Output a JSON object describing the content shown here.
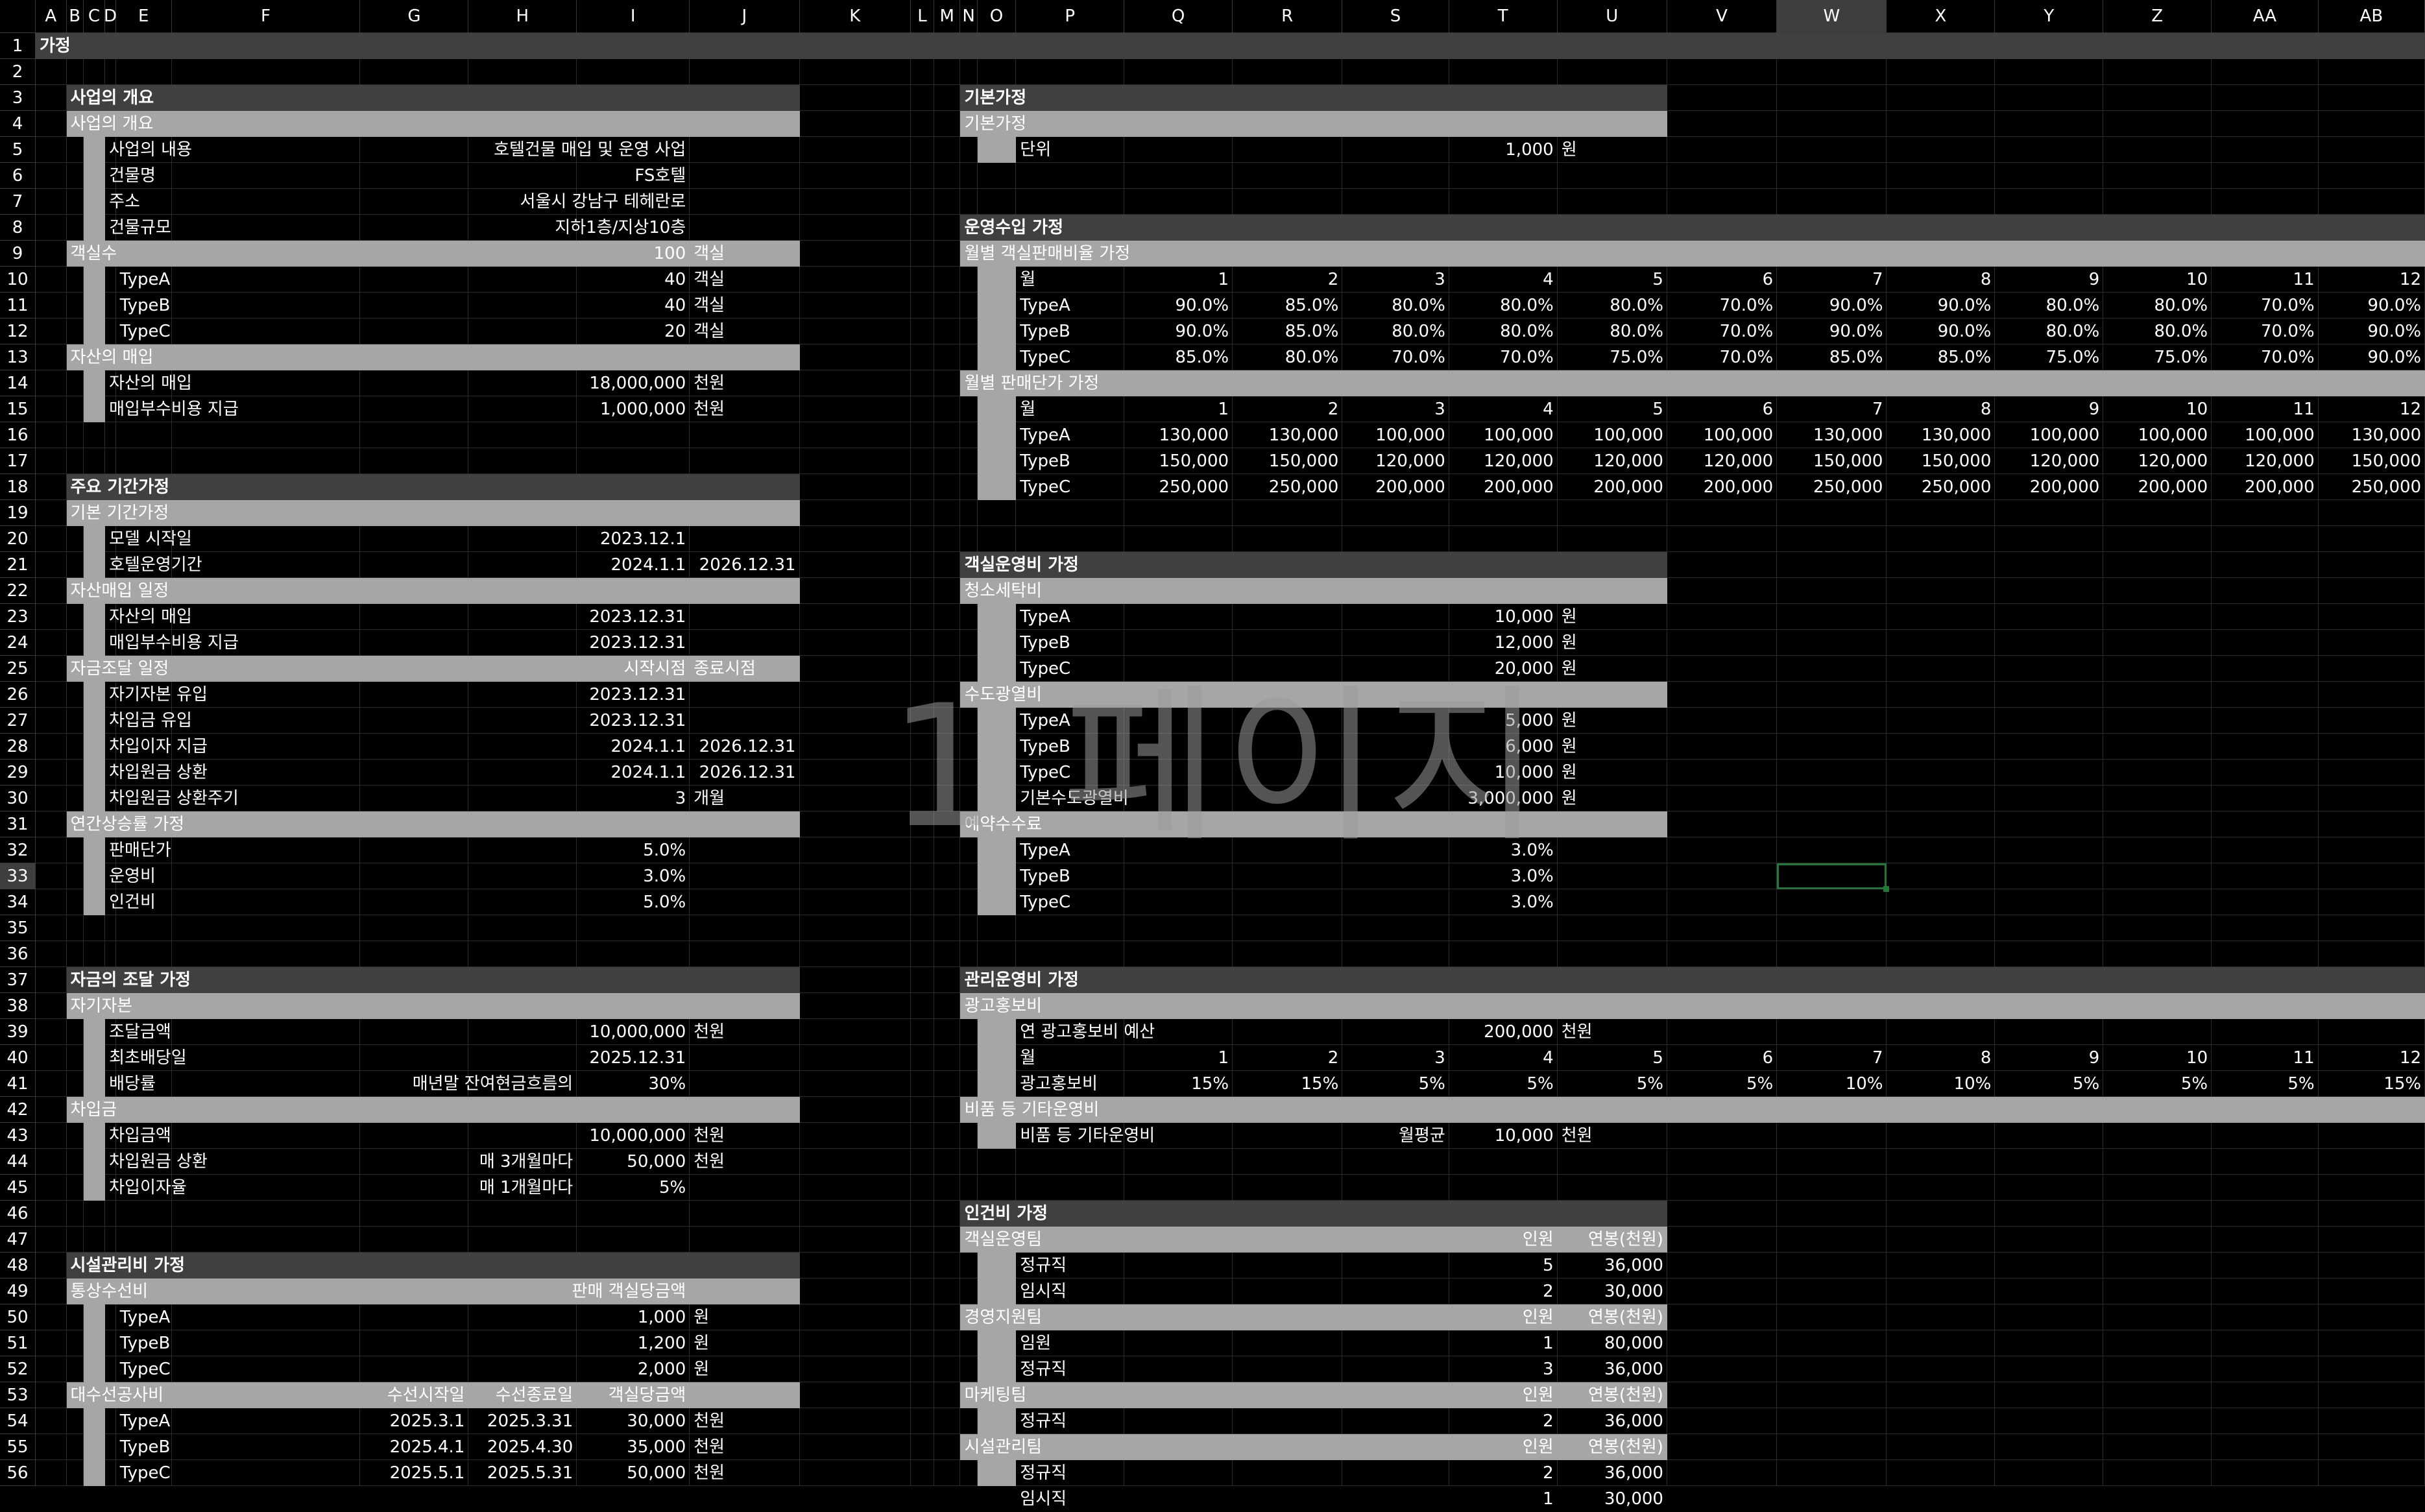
{
  "sheet": {
    "columns": [
      "A",
      "B",
      "C",
      "D",
      "E",
      "F",
      "G",
      "H",
      "I",
      "J",
      "K",
      "L",
      "M",
      "N",
      "O",
      "P",
      "Q",
      "R",
      "S",
      "T",
      "U",
      "V",
      "W",
      "X",
      "Y",
      "Z",
      "AA",
      "AB"
    ],
    "selected_column": "W",
    "selected_row": "33",
    "page_watermark": "1 페이지"
  },
  "title_row": "가정",
  "left": {
    "s1_title": "사업의 개요",
    "s1_sub": "사업의 개요",
    "s1_rows": [
      {
        "label": "사업의 내용",
        "val": "호텔건물 매입 및 운영 사업"
      },
      {
        "label": "건물명",
        "val": "FS호텔"
      },
      {
        "label": "주소",
        "val": "서울시 강남구 테헤란로"
      },
      {
        "label": "건물규모",
        "val": "지하1층/지상10층"
      }
    ],
    "rooms_label": "객실수",
    "rooms_val": "100",
    "rooms_unit": "객실",
    "rooms_rows": [
      {
        "label": "TypeA",
        "val": "40",
        "unit": "객실"
      },
      {
        "label": "TypeB",
        "val": "40",
        "unit": "객실"
      },
      {
        "label": "TypeC",
        "val": "20",
        "unit": "객실"
      }
    ],
    "asset_label": "자산의 매입",
    "asset_rows": [
      {
        "label": "자산의 매입",
        "val": "18,000,000",
        "unit": "천원"
      },
      {
        "label": "매입부수비용 지급",
        "val": "1,000,000",
        "unit": "천원"
      }
    ],
    "s2_title": "주요 기간가정",
    "basic_period": "기본 기간가정",
    "basic_rows": [
      {
        "label": "모델 시작일",
        "v1": "2023.12.1",
        "v2": ""
      },
      {
        "label": "호텔운영기간",
        "v1": "2024.1.1",
        "v2": "2026.12.31"
      }
    ],
    "asset_sched": "자산매입 일정",
    "asset_sched_rows": [
      {
        "label": "자산의 매입",
        "v1": "2023.12.31"
      },
      {
        "label": "매입부수비용 지급",
        "v1": "2023.12.31"
      }
    ],
    "fund_sched": "자금조달 일정",
    "fund_start": "시작시점",
    "fund_end": "종료시점",
    "fund_rows": [
      {
        "label": "자기자본 유입",
        "v1": "2023.12.31",
        "v2": ""
      },
      {
        "label": "차입금 유입",
        "v1": "2023.12.31",
        "v2": ""
      },
      {
        "label": "차입이자 지급",
        "v1": "2024.1.1",
        "v2": "2026.12.31"
      },
      {
        "label": "차입원금 상환",
        "v1": "2024.1.1",
        "v2": "2026.12.31"
      },
      {
        "label": "차입원금 상환주기",
        "v1": "3",
        "v2": "개월"
      }
    ],
    "growth": "연간상승률 가정",
    "growth_rows": [
      {
        "label": "판매단가",
        "v1": "5.0%"
      },
      {
        "label": "운영비",
        "v1": "3.0%"
      },
      {
        "label": "인건비",
        "v1": "5.0%"
      }
    ],
    "s3_title": "자금의 조달 가정",
    "equity": "자기자본",
    "equity_rows": [
      {
        "label": "조달금액",
        "mid": "",
        "v1": "10,000,000",
        "unit": "천원"
      },
      {
        "label": "최초배당일",
        "mid": "",
        "v1": "2025.12.31",
        "unit": ""
      },
      {
        "label": "배당률",
        "mid": "매년말 잔여현금흐름의",
        "v1": "30%",
        "unit": ""
      }
    ],
    "loan": "차입금",
    "loan_rows": [
      {
        "label": "차입금액",
        "mid": "",
        "v1": "10,000,000",
        "unit": "천원"
      },
      {
        "label": "차입원금 상환",
        "mid": "매 3개월마다",
        "v1": "50,000",
        "unit": "천원"
      },
      {
        "label": "차입이자율",
        "mid": "매 1개월마다",
        "v1": "5%",
        "unit": ""
      }
    ],
    "s4_title": "시설관리비 가정",
    "repair": "통상수선비",
    "repair_hdr": "판매 객실당금액",
    "repair_rows": [
      {
        "label": "TypeA",
        "v1": "1,000",
        "unit": "원"
      },
      {
        "label": "TypeB",
        "v1": "1,200",
        "unit": "원"
      },
      {
        "label": "TypeC",
        "v1": "2,000",
        "unit": "원"
      }
    ],
    "major": "대수선공사비",
    "major_h1": "수선시작일",
    "major_h2": "수선종료일",
    "major_h3": "객실당금액",
    "major_rows": [
      {
        "label": "TypeA",
        "d1": "2025.3.1",
        "d2": "2025.3.31",
        "v1": "30,000",
        "unit": "천원"
      },
      {
        "label": "TypeB",
        "d1": "2025.4.1",
        "d2": "2025.4.30",
        "v1": "35,000",
        "unit": "천원"
      },
      {
        "label": "TypeC",
        "d1": "2025.5.1",
        "d2": "2025.5.31",
        "v1": "50,000",
        "unit": "천원"
      }
    ]
  },
  "right": {
    "basic_title": "기본가정",
    "basic_sub": "기본가정",
    "unit_label": "단위",
    "unit_val": "1,000",
    "unit_unit": "원",
    "rev_title": "운영수입 가정",
    "occ_sub": "월별 객실판매비율 가정",
    "month_label": "월",
    "months": [
      "1",
      "2",
      "3",
      "4",
      "5",
      "6",
      "7",
      "8",
      "9",
      "10",
      "11",
      "12"
    ],
    "occ_rows": [
      {
        "label": "TypeA",
        "vals": [
          "90.0%",
          "85.0%",
          "80.0%",
          "80.0%",
          "80.0%",
          "70.0%",
          "90.0%",
          "90.0%",
          "80.0%",
          "80.0%",
          "70.0%",
          "90.0%"
        ]
      },
      {
        "label": "TypeB",
        "vals": [
          "90.0%",
          "85.0%",
          "80.0%",
          "80.0%",
          "80.0%",
          "70.0%",
          "90.0%",
          "90.0%",
          "80.0%",
          "80.0%",
          "70.0%",
          "90.0%"
        ]
      },
      {
        "label": "TypeC",
        "vals": [
          "85.0%",
          "80.0%",
          "70.0%",
          "70.0%",
          "75.0%",
          "70.0%",
          "85.0%",
          "85.0%",
          "75.0%",
          "75.0%",
          "70.0%",
          "90.0%"
        ]
      }
    ],
    "price_sub": "월별 판매단가 가정",
    "price_rows": [
      {
        "label": "TypeA",
        "vals": [
          "130,000",
          "130,000",
          "100,000",
          "100,000",
          "100,000",
          "100,000",
          "130,000",
          "130,000",
          "100,000",
          "100,000",
          "100,000",
          "130,000"
        ]
      },
      {
        "label": "TypeB",
        "vals": [
          "150,000",
          "150,000",
          "120,000",
          "120,000",
          "120,000",
          "120,000",
          "150,000",
          "150,000",
          "120,000",
          "120,000",
          "120,000",
          "150,000"
        ]
      },
      {
        "label": "TypeC",
        "vals": [
          "250,000",
          "250,000",
          "200,000",
          "200,000",
          "200,000",
          "200,000",
          "250,000",
          "250,000",
          "200,000",
          "200,000",
          "200,000",
          "250,000"
        ]
      }
    ],
    "roomop_title": "객실운영비 가정",
    "clean": "청소세탁비",
    "clean_rows": [
      {
        "label": "TypeA",
        "val": "10,000",
        "unit": "원"
      },
      {
        "label": "TypeB",
        "val": "12,000",
        "unit": "원"
      },
      {
        "label": "TypeC",
        "val": "20,000",
        "unit": "원"
      }
    ],
    "util": "수도광열비",
    "util_rows": [
      {
        "label": "TypeA",
        "val": "5,000",
        "unit": "원"
      },
      {
        "label": "TypeB",
        "val": "6,000",
        "unit": "원"
      },
      {
        "label": "TypeC",
        "val": "10,000",
        "unit": "원"
      },
      {
        "label": "기본수도광열비",
        "val": "3,000,000",
        "unit": "원"
      }
    ],
    "book": "예약수수료",
    "book_rows": [
      {
        "label": "TypeA",
        "val": "3.0%"
      },
      {
        "label": "TypeB",
        "val": "3.0%"
      },
      {
        "label": "TypeC",
        "val": "3.0%"
      }
    ],
    "mgmt_title": "관리운영비 가정",
    "adv": "광고홍보비",
    "adv_budget_label": "연 광고홍보비 예산",
    "adv_budget_val": "200,000",
    "adv_budget_unit": "천원",
    "adv_row_label": "광고홍보비",
    "adv_vals": [
      "15%",
      "15%",
      "5%",
      "5%",
      "5%",
      "5%",
      "10%",
      "10%",
      "5%",
      "5%",
      "5%",
      "15%"
    ],
    "misc": "비품 등 기타운영비",
    "misc_label": "비품 등 기타운영비",
    "misc_mid": "월평균",
    "misc_val": "10,000",
    "misc_unit": "천원",
    "labor_title": "인건비 가정",
    "head_label": "인원",
    "salary_label": "연봉(천원)",
    "teams": [
      {
        "name": "객실운영팀",
        "rows": [
          {
            "label": "정규직",
            "n": "5",
            "s": "36,000"
          },
          {
            "label": "임시직",
            "n": "2",
            "s": "30,000"
          }
        ]
      },
      {
        "name": "경영지원팀",
        "rows": [
          {
            "label": "임원",
            "n": "1",
            "s": "80,000"
          },
          {
            "label": "정규직",
            "n": "3",
            "s": "36,000"
          }
        ]
      },
      {
        "name": "마케팅팀",
        "rows": [
          {
            "label": "정규직",
            "n": "2",
            "s": "36,000"
          }
        ]
      },
      {
        "name": "시설관리팀",
        "rows": [
          {
            "label": "정규직",
            "n": "2",
            "s": "36,000"
          },
          {
            "label": "임시직",
            "n": "1",
            "s": "30,000"
          }
        ]
      }
    ]
  }
}
